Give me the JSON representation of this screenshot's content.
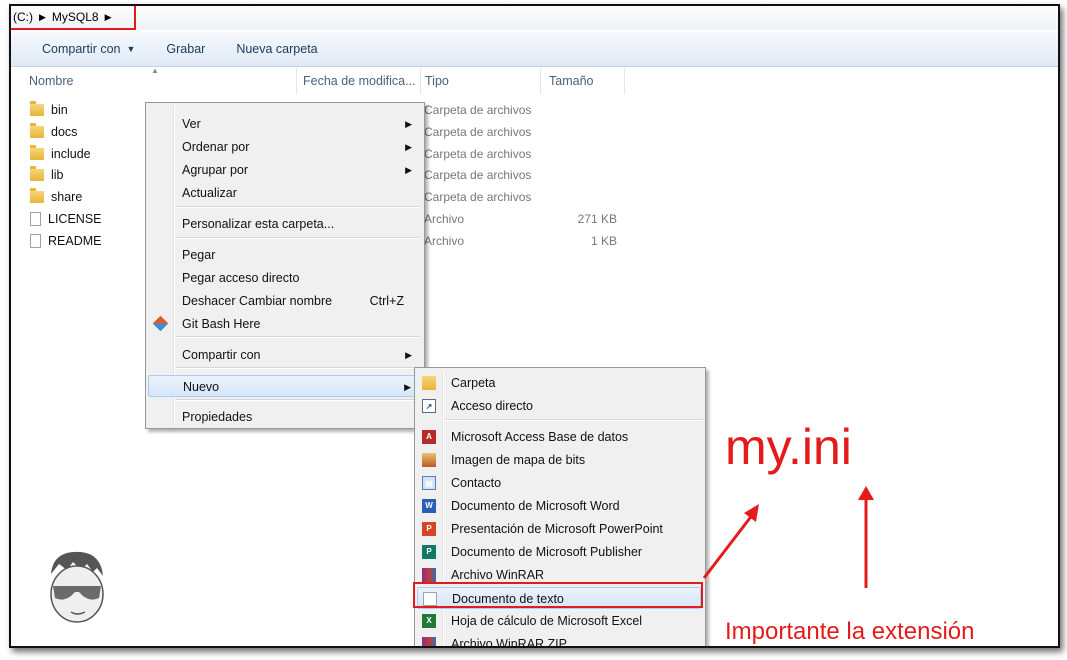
{
  "breadcrumb": {
    "items": [
      "(C:)",
      "MySQL8"
    ]
  },
  "toolbar": {
    "share": "Compartir con",
    "burn": "Grabar",
    "new_folder": "Nueva carpeta"
  },
  "columns": {
    "name": "Nombre",
    "date": "Fecha de modifica...",
    "type": "Tipo",
    "size": "Tamaño"
  },
  "files": [
    {
      "name": "bin",
      "icon": "folder-icon",
      "type": "Carpeta de archivos",
      "size": ""
    },
    {
      "name": "docs",
      "icon": "folder-icon",
      "type": "Carpeta de archivos",
      "size": ""
    },
    {
      "name": "include",
      "icon": "folder-icon",
      "type": "Carpeta de archivos",
      "size": ""
    },
    {
      "name": "lib",
      "icon": "folder-icon",
      "type": "Carpeta de archivos",
      "size": ""
    },
    {
      "name": "share",
      "icon": "folder-icon",
      "type": "Carpeta de archivos",
      "size": ""
    },
    {
      "name": "LICENSE",
      "icon": "file-icon",
      "type": "Archivo",
      "size": "271 KB"
    },
    {
      "name": "README",
      "icon": "file-icon",
      "type": "Archivo",
      "size": "1 KB"
    }
  ],
  "context_menu": {
    "items": [
      {
        "label": "Ver",
        "submenu": true
      },
      {
        "label": "Ordenar por",
        "submenu": true
      },
      {
        "label": "Agrupar por",
        "submenu": true
      },
      {
        "label": "Actualizar"
      },
      {
        "label": "Personalizar esta carpeta..."
      },
      {
        "label": "Pegar"
      },
      {
        "label": "Pegar acceso directo"
      },
      {
        "label": "Deshacer Cambiar nombre",
        "shortcut": "Ctrl+Z"
      },
      {
        "label": "Git Bash Here",
        "icon": "git-icon"
      },
      {
        "label": "Compartir con",
        "submenu": true
      },
      {
        "label": "Nuevo",
        "submenu": true,
        "highlighted": true
      },
      {
        "label": "Propiedades"
      }
    ]
  },
  "new_submenu": {
    "items": [
      {
        "label": "Carpeta",
        "icon": "folder-icon"
      },
      {
        "label": "Acceso directo",
        "icon": "shortcut-icon"
      },
      {
        "label": "Microsoft Access Base de datos",
        "icon": "access-icon"
      },
      {
        "label": "Imagen de mapa de bits",
        "icon": "bitmap-icon"
      },
      {
        "label": "Contacto",
        "icon": "contact-icon"
      },
      {
        "label": "Documento de Microsoft Word",
        "icon": "word-icon"
      },
      {
        "label": "Presentación de Microsoft PowerPoint",
        "icon": "powerpoint-icon"
      },
      {
        "label": "Documento de Microsoft Publisher",
        "icon": "publisher-icon"
      },
      {
        "label": "Archivo WinRAR",
        "icon": "winrar-icon"
      },
      {
        "label": "Documento de texto",
        "icon": "text-document-icon",
        "highlighted": true
      },
      {
        "label": "Hoja de cálculo de Microsoft Excel",
        "icon": "excel-icon"
      },
      {
        "label": "Archivo WinRAR ZIP",
        "icon": "winrar-zip-icon"
      }
    ]
  },
  "annotations": {
    "filename": "my.ini",
    "note": "Importante la extensión",
    "color": "#e31b1b"
  }
}
